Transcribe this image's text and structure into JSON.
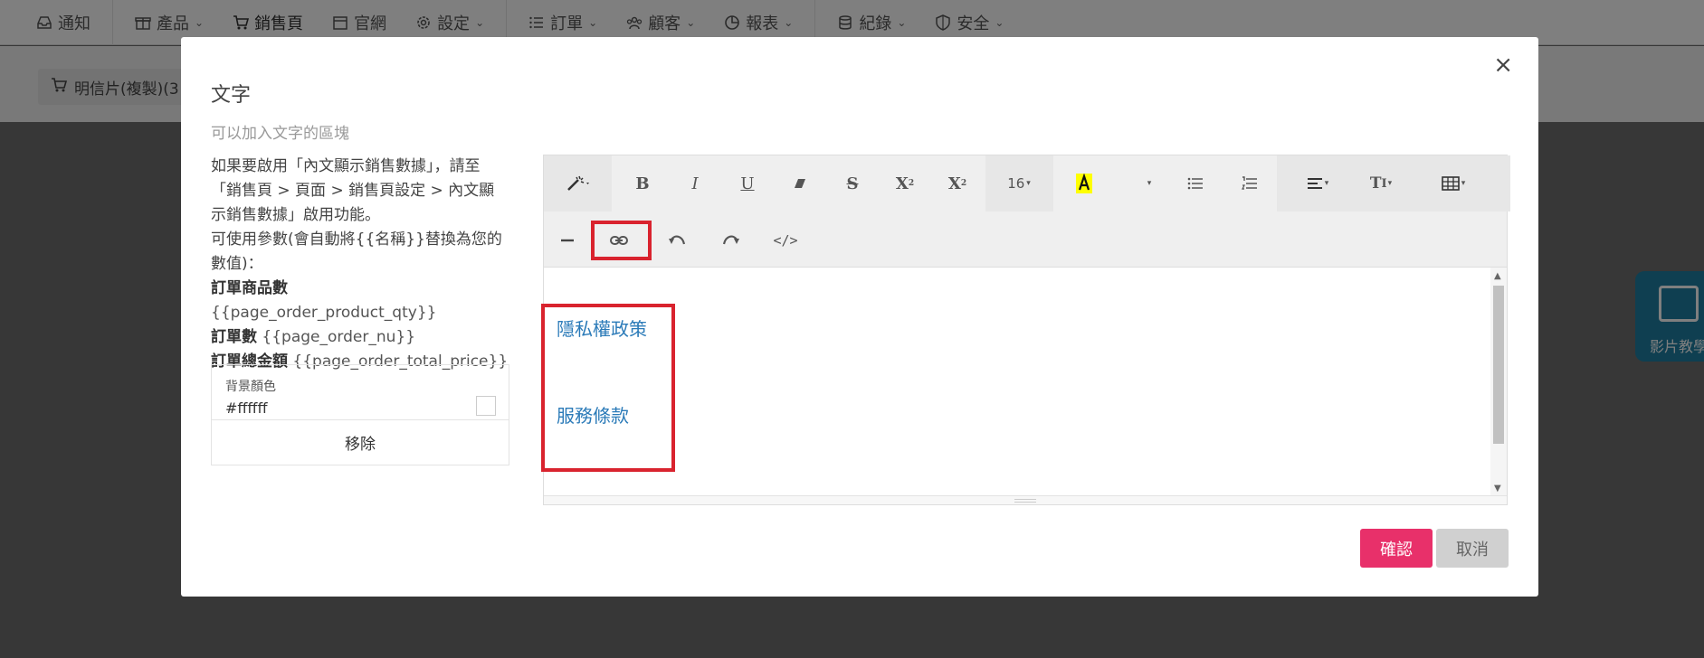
{
  "topnav": {
    "items": [
      {
        "label": "通知",
        "icon": "inbox-icon"
      },
      {
        "label": "產品",
        "icon": "gift-icon",
        "dropdown": true
      },
      {
        "label": "銷售頁",
        "icon": "cart-icon"
      },
      {
        "label": "官網",
        "icon": "storefront-icon"
      },
      {
        "label": "設定",
        "icon": "gear-icon",
        "dropdown": true
      },
      {
        "label": "訂單",
        "icon": "list-icon",
        "dropdown": true
      },
      {
        "label": "顧客",
        "icon": "users-icon",
        "dropdown": true
      },
      {
        "label": "報表",
        "icon": "pie-chart-icon",
        "dropdown": true
      },
      {
        "label": "紀錄",
        "icon": "database-icon",
        "dropdown": true
      },
      {
        "label": "安全",
        "icon": "shield-icon",
        "dropdown": true
      }
    ]
  },
  "breadcrumb": {
    "label": "明信片(複製)(3"
  },
  "video_button": {
    "label": "影片教學"
  },
  "modal": {
    "title": "文字",
    "subtitle": "可以加入文字的區塊",
    "description": "如果要啟用「內文顯示銷售數據」，請至「銷售頁 > 頁面 > 銷售頁設定 > 內文顯示銷售數據」啟用功能。",
    "params_intro": "可使用參數(會自動將{{名稱}}替換為您的數值)：",
    "params": [
      {
        "name": "訂單商品數",
        "code": "{{page_order_product_qty}}"
      },
      {
        "name": "訂單數",
        "code": "{{page_order_nu}}"
      },
      {
        "name": "訂單總金額",
        "code": "{{page_order_total_price}}"
      }
    ],
    "background": {
      "label": "背景顏色",
      "value": "#ffffff",
      "remove_label": "移除"
    },
    "toolbar": {
      "font_size": "16"
    },
    "content": {
      "link1": "隱私權政策",
      "link2": "服務條款"
    },
    "confirm_label": "確認",
    "cancel_label": "取消",
    "close_label": "×"
  },
  "colors": {
    "accent": "#e8306a",
    "link": "#2a7ab8",
    "highlight_box": "#d9232e",
    "text_highlight": "#ffff00"
  }
}
